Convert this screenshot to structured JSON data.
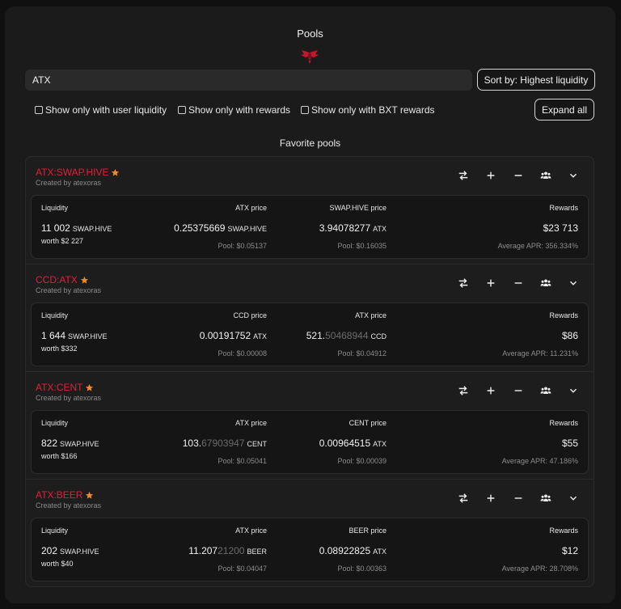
{
  "header": {
    "title": "Pools"
  },
  "search": {
    "value": "ATX"
  },
  "sort": {
    "label": "Sort by: Highest liquidity"
  },
  "filters": [
    "Show only with user liquidity",
    "Show only with rewards",
    "Show only with BXT rewards"
  ],
  "expand_all": "Expand all",
  "section_title": "Favorite pools",
  "labels": {
    "liquidity": "Liquidity",
    "rewards": "Rewards"
  },
  "colors": {
    "accent": "#e0203a",
    "star": "#f08a24"
  },
  "pools": [
    {
      "name": "ATX:SWAP.HIVE",
      "creator": "Created by atexoras",
      "liquidity": "11 002",
      "liquidity_unit": "SWAP.HIVE",
      "worth": "worth $2 227",
      "price1_label": "ATX price",
      "price1_main": "0.25375669",
      "price1_dim": "",
      "price1_unit": "SWAP.HIVE",
      "price1_pool": "Pool: $0.05137",
      "price2_label": "SWAP.HIVE price",
      "price2_main": "3.94078277",
      "price2_dim": "",
      "price2_unit": "ATX",
      "price2_pool": "Pool: $0.16035",
      "rewards": "$23 713",
      "apr_main": "Average APR: 356.",
      "apr_dim": "334",
      "apr_end": "%"
    },
    {
      "name": "CCD:ATX",
      "creator": "Created by atexoras",
      "liquidity": "1 644",
      "liquidity_unit": "SWAP.HIVE",
      "worth": "worth $332",
      "price1_label": "CCD price",
      "price1_main": "0.00191752",
      "price1_dim": "",
      "price1_unit": "ATX",
      "price1_pool": "Pool: $0.00008",
      "price2_label": "ATX price",
      "price2_main": "521.",
      "price2_dim": "50468944",
      "price2_unit": "CCD",
      "price2_pool": "Pool: $0.04912",
      "rewards": "$86",
      "apr_main": "Average APR: 11.231%",
      "apr_dim": "",
      "apr_end": ""
    },
    {
      "name": "ATX:CENT",
      "creator": "Created by atexoras",
      "liquidity": "822",
      "liquidity_unit": "SWAP.HIVE",
      "worth": "worth $166",
      "price1_label": "ATX price",
      "price1_main": "103.",
      "price1_dim": "67903947",
      "price1_unit": "CENT",
      "price1_pool": "Pool: $0.05041",
      "price2_label": "CENT price",
      "price2_main": "0.00964515",
      "price2_dim": "",
      "price2_unit": "ATX",
      "price2_pool": "Pool: $0.00039",
      "rewards": "$55",
      "apr_main": "Average APR: 47.186%",
      "apr_dim": "",
      "apr_end": ""
    },
    {
      "name": "ATX:BEER",
      "creator": "Created by atexoras",
      "liquidity": "202",
      "liquidity_unit": "SWAP.HIVE",
      "worth": "worth $40",
      "price1_label": "ATX price",
      "price1_main": "11.207",
      "price1_dim": "21200",
      "price1_unit": "BEER",
      "price1_pool": "Pool: $0.04047",
      "price2_label": "BEER price",
      "price2_main": "0.08922825",
      "price2_dim": "",
      "price2_unit": "ATX",
      "price2_pool": "Pool: $0.00363",
      "rewards": "$12",
      "apr_main": "Average APR: 28.708%",
      "apr_dim": "",
      "apr_end": ""
    }
  ],
  "icons": [
    "logo-icon",
    "star-icon",
    "swap-icon",
    "plus-icon",
    "minus-icon",
    "users-icon",
    "chevron-down-icon"
  ]
}
